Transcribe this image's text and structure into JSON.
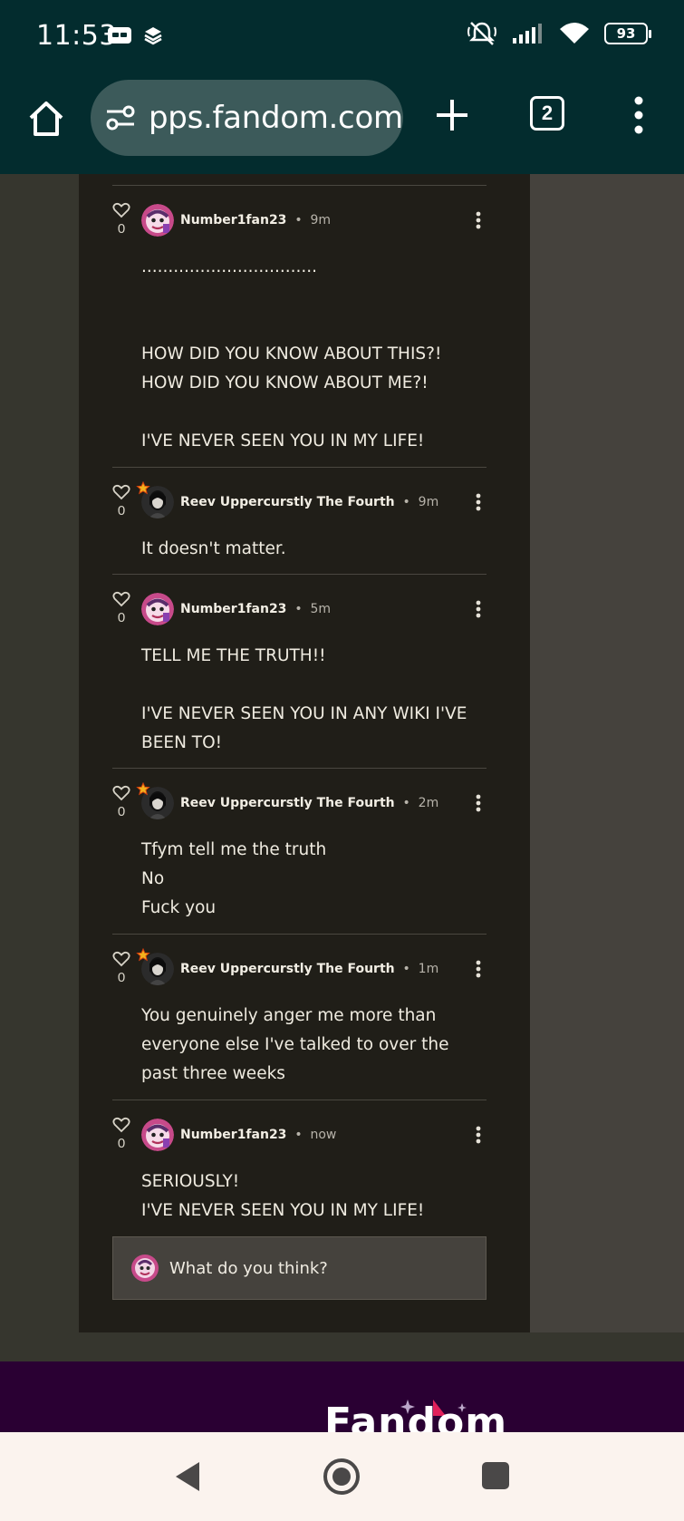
{
  "status": {
    "time": "11:53",
    "battery": "93"
  },
  "browser": {
    "url": "pps.fandom.com",
    "tab_count": "2"
  },
  "comments": [
    {
      "likes": "0",
      "author": "Number1fan23",
      "time": "9m",
      "body": ".................................\n\n\nHOW DID YOU KNOW ABOUT THIS?!\nHOW DID YOU KNOW ABOUT ME?!\n\nI'VE NEVER SEEN YOU IN MY LIFE!"
    },
    {
      "likes": "0",
      "author": "Reev Uppercurstly The Fourth",
      "time": "9m",
      "body": "It doesn't matter."
    },
    {
      "likes": "0",
      "author": "Number1fan23",
      "time": "5m",
      "body": "TELL ME THE TRUTH!!\n\nI'VE NEVER SEEN YOU IN ANY WIKI I'VE BEEN TO!"
    },
    {
      "likes": "0",
      "author": "Reev Uppercurstly The Fourth",
      "time": "2m",
      "body": "Tfym tell me the truth\nNo\nFuck you"
    },
    {
      "likes": "0",
      "author": "Reev Uppercurstly The Fourth",
      "time": "1m",
      "body": "You genuinely anger me more than everyone else I've talked to over the past three weeks"
    },
    {
      "likes": "0",
      "author": "Number1fan23",
      "time": "now",
      "body": "SERIOUSLY!\nI'VE NEVER SEEN YOU IN MY LIFE!"
    }
  ],
  "reply": {
    "placeholder": "What do you think?"
  },
  "footer": {
    "logo": "Fandom"
  },
  "colors": {
    "chrome": "#032c2e",
    "panel": "#201e18",
    "footer": "#2a0033",
    "badge": "#f2b21d"
  },
  "icons": [
    "home-icon",
    "site-settings-icon",
    "plus-icon",
    "tabs-icon",
    "overflow-menu-icon",
    "heart-icon",
    "kebab-icon",
    "back-icon",
    "home-nav-icon",
    "recents-icon"
  ]
}
